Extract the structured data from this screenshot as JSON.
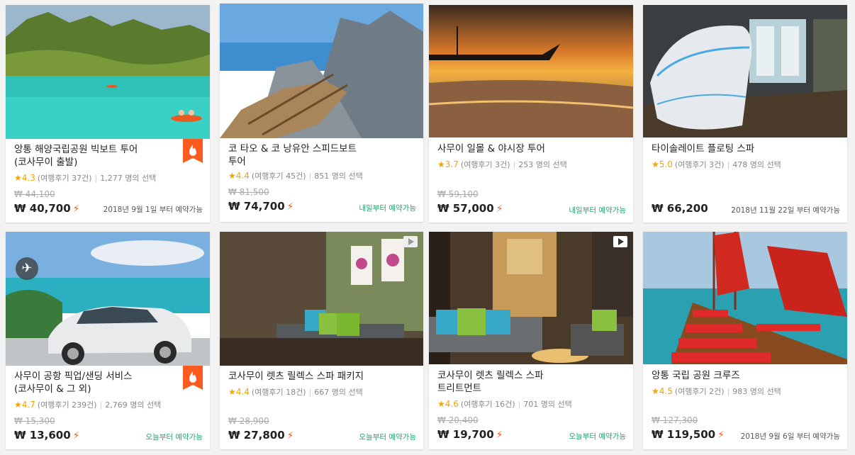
{
  "cards": [
    {
      "title": "앙통 해양국립공원 빅보트 투어\n(코사무이 출발)",
      "score": "4.3",
      "reviews": "(여행후기 37건)",
      "choices": "1,277 명의 선택",
      "old_price": "₩ 44,100",
      "price": "₩ 40,700",
      "availability": "2018년 9월 1일 부터 예약가능",
      "hot": true
    },
    {
      "title": "코 타오 & 코 낭유안 스피드보트\n투어",
      "score": "4.4",
      "reviews": "(여행후기 45건)",
      "choices": "851 명의 선택",
      "old_price": "₩ 81,500",
      "price": "₩ 74,700",
      "availability": "내일부터 예약가능"
    },
    {
      "title": "사무이 일몰 & 야시장 투어",
      "score": "3.7",
      "reviews": "(여행후기 3건)",
      "choices": "253 명의 선택",
      "old_price": "₩ 59,100",
      "price": "₩ 57,000",
      "availability": "내일부터 예약가능"
    },
    {
      "title": "타이솔레이트 플로팅 스파",
      "score": "5.0",
      "reviews": "(여행후기 3건)",
      "choices": "478 명의 선택",
      "old_price": "",
      "price": "₩ 66,200",
      "availability": "2018년 11월 22일 부터 예약가능"
    },
    {
      "title": "사무이 공항 픽업/샌딩 서비스\n(코사무이 & 그 외)",
      "score": "4.7",
      "reviews": "(여행후기 239건)",
      "choices": "2,769 명의 선택",
      "old_price": "₩ 15,300",
      "price": "₩ 13,600",
      "availability": "오늘부터 예약가능",
      "hot": true
    },
    {
      "title": "코사무이 렛츠 릴렉스 스파 패키지",
      "score": "4.4",
      "reviews": "(여행후기 18건)",
      "choices": "667 명의 선택",
      "old_price": "₩ 28,900",
      "price": "₩ 27,800",
      "availability": "오늘부터 예약가능"
    },
    {
      "title": "코사무이 렛츠 릴렉스 스파\n트리트먼트",
      "score": "4.6",
      "reviews": "(여행후기 16건)",
      "choices": "701 명의 선택",
      "old_price": "₩ 20,400",
      "price": "₩ 19,700",
      "availability": "오늘부터 예약가능"
    },
    {
      "title": "앙통 국립 공원 크루즈",
      "score": "4.5",
      "reviews": "(여행후기 2건)",
      "choices": "983 명의 선택",
      "old_price": "₩ 127,300",
      "price": "₩ 119,500",
      "availability": "2018년 9월 6일 부터 예약가능"
    }
  ],
  "icons": {
    "star": "★",
    "bolt": "⚡",
    "plane": "✈",
    "play": "play-icon",
    "hot": "fire-icon"
  },
  "colors": {
    "star": "#f0a500",
    "bolt": "#ff5a1f",
    "hot_badge": "#ff5a1f",
    "availability_green": "#27a56a"
  }
}
